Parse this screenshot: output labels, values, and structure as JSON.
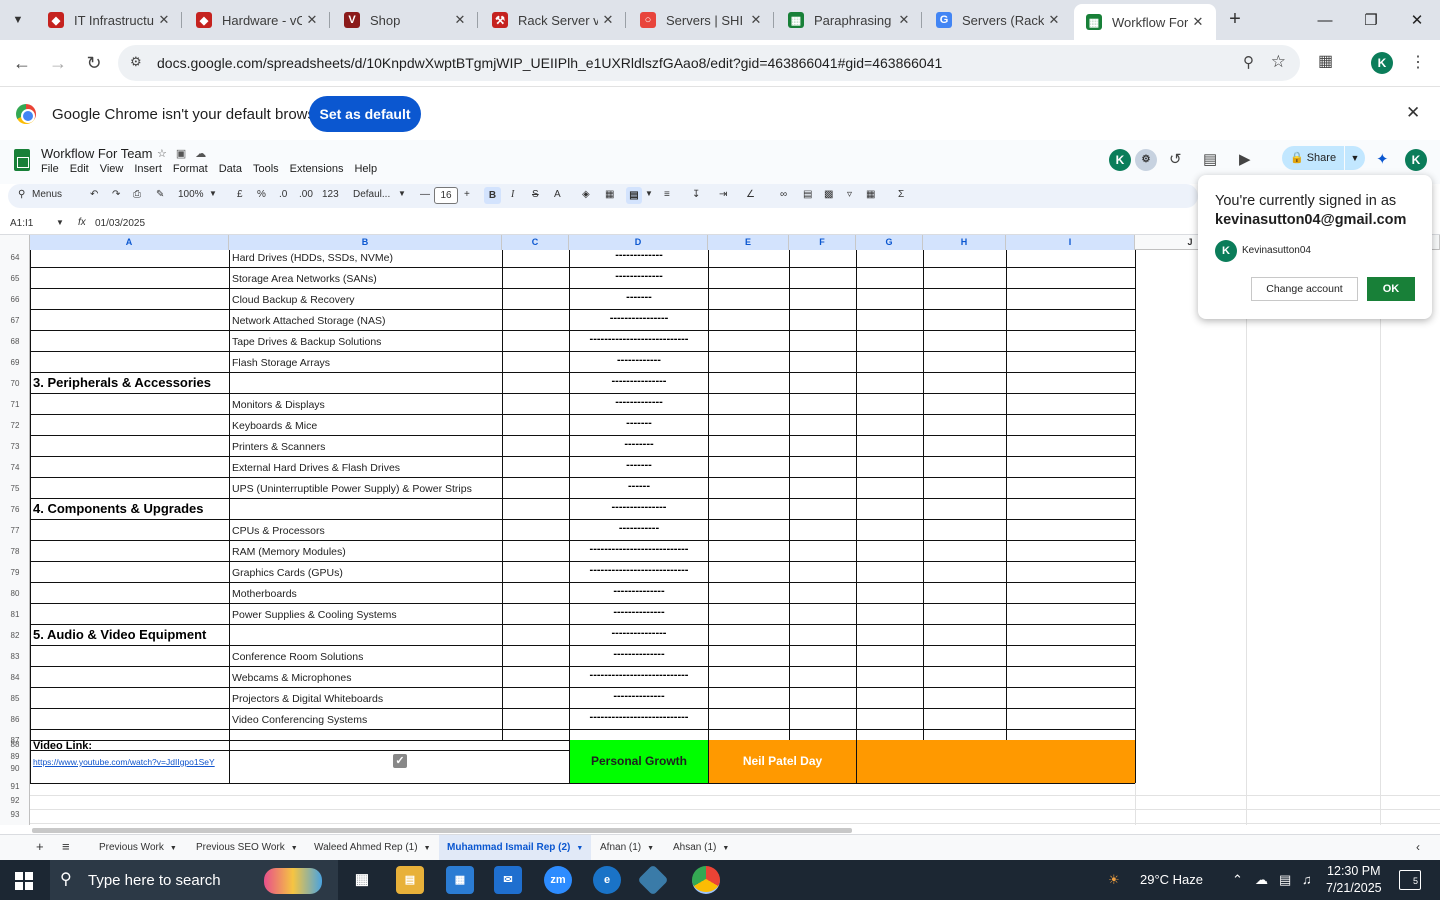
{
  "browser": {
    "tabs": [
      {
        "title": "IT Infrastructure",
        "favicon": "hardware-icon",
        "color": "#c5221f"
      },
      {
        "title": "Hardware - vC",
        "favicon": "hardware-icon",
        "color": "#c5221f"
      },
      {
        "title": "Shop",
        "favicon": "v-logo-icon",
        "color": "#8b1a1a"
      },
      {
        "title": "Rack Server vs",
        "favicon": "tool-icon",
        "color": "#c5221f"
      },
      {
        "title": "Servers | SHI",
        "favicon": "shi-circle-icon",
        "color": "#e8453c"
      },
      {
        "title": "Paraphrasing T",
        "favicon": "sheets-icon",
        "color": "#188038"
      },
      {
        "title": "Servers (Rack,",
        "favicon": "google-icon",
        "color": "#4285f4"
      },
      {
        "title": "Workflow For",
        "favicon": "sheets-icon",
        "color": "#188038"
      }
    ],
    "active_tab_index": 7,
    "url": "docs.google.com/spreadsheets/d/10KnpdwXwptBTgmjWIP_UEIIPlh_e1UXRldlszfGAao8/edit?gid=463866041#gid=463866041",
    "profile_initial": "K"
  },
  "banner": {
    "message": "Google Chrome isn't your default browser",
    "button": "Set as default"
  },
  "sheet": {
    "title": "Workflow For Team",
    "menus": [
      "File",
      "Edit",
      "View",
      "Insert",
      "Format",
      "Data",
      "Tools",
      "Extensions",
      "Help"
    ],
    "share_label": "Share",
    "avatar_initial": "K",
    "toolbar": {
      "menus_label": "Menus",
      "zoom": "100%",
      "currency": "£",
      "percent": "%",
      "dec_decrease": ".0",
      "dec_increase": ".00",
      "number_format": "123",
      "font": "Defaul...",
      "font_size": "16"
    },
    "name_box": "A1:I1",
    "formula_value": "01/03/2025"
  },
  "grid": {
    "columns": [
      "A",
      "B",
      "C",
      "D",
      "E",
      "F",
      "G",
      "H",
      "I",
      "J"
    ],
    "row_numbers": [
      "64",
      "65",
      "66",
      "67",
      "68",
      "69",
      "70",
      "71",
      "72",
      "73",
      "74",
      "75",
      "76",
      "77",
      "78",
      "79",
      "80",
      "81",
      "82",
      "83",
      "84",
      "85",
      "86",
      "87",
      "88",
      "89",
      "90",
      "91",
      "92",
      "93"
    ],
    "rows": [
      {
        "a": "",
        "b": "Hard Drives (HDDs, SSDs, NVMe)",
        "d": "-------------"
      },
      {
        "a": "",
        "b": "Storage Area Networks (SANs)",
        "d": "-------------"
      },
      {
        "a": "",
        "b": "Cloud Backup & Recovery",
        "d": "-------"
      },
      {
        "a": "",
        "b": "Network Attached Storage (NAS)",
        "d": "----------------"
      },
      {
        "a": "",
        "b": "Tape Drives & Backup Solutions",
        "d": "---------------------------"
      },
      {
        "a": "",
        "b": "Flash Storage Arrays",
        "d": "------------"
      },
      {
        "a": "3. Peripherals & Accessories",
        "b": "",
        "d": "---------------"
      },
      {
        "a": "",
        "b": "Monitors & Displays",
        "d": "-------------"
      },
      {
        "a": "",
        "b": "Keyboards & Mice",
        "d": "-------"
      },
      {
        "a": "",
        "b": "Printers & Scanners",
        "d": "--------"
      },
      {
        "a": "",
        "b": "External Hard Drives & Flash Drives",
        "d": "-------"
      },
      {
        "a": "",
        "b": "UPS (Uninterruptible Power Supply) & Power Strips",
        "d": "------"
      },
      {
        "a": "4. Components & Upgrades",
        "b": "",
        "d": "---------------"
      },
      {
        "a": "",
        "b": "CPUs & Processors",
        "d": "-----------"
      },
      {
        "a": "",
        "b": "RAM (Memory Modules)",
        "d": "---------------------------"
      },
      {
        "a": "",
        "b": "Graphics Cards (GPUs)",
        "d": "---------------------------"
      },
      {
        "a": "",
        "b": "Motherboards",
        "d": "--------------"
      },
      {
        "a": "",
        "b": "Power Supplies & Cooling Systems",
        "d": "--------------"
      },
      {
        "a": "5. Audio & Video Equipment",
        "b": "",
        "d": "---------------"
      },
      {
        "a": "",
        "b": "Conference Room Solutions",
        "d": "--------------"
      },
      {
        "a": "",
        "b": "Webcams & Microphones",
        "d": "---------------------------"
      },
      {
        "a": "",
        "b": "Projectors & Digital Whiteboards",
        "d": "--------------"
      },
      {
        "a": "",
        "b": "Video Conferencing Systems",
        "d": "---------------------------"
      }
    ],
    "video_label": "Video Link:",
    "video_url": "https://www.youtube.com/watch?v=JdIIgpo1SeY",
    "personal_growth": "Personal Growth",
    "neil_patel_day": "Neil Patel Day",
    "green": "#00ff00",
    "orange": "#ff9900"
  },
  "signin_popup": {
    "line1": "You're currently signed in as",
    "email": "kevinasutton04@gmail.com",
    "account_name": "Kevinasutton04",
    "change_button": "Change account",
    "ok_button": "OK"
  },
  "sheet_tabs": [
    "Previous Work",
    "Previous SEO Work",
    "Waleed Ahmed Rep (1)",
    "Muhammad Ismail Rep (2)",
    "Afnan (1)",
    "Ahsan (1)"
  ],
  "active_sheet_index": 3,
  "taskbar": {
    "search_placeholder": "Type here to search",
    "weather": "29°C  Haze",
    "time": "12:30 PM",
    "date": "7/21/2025",
    "notification_count": "5"
  }
}
